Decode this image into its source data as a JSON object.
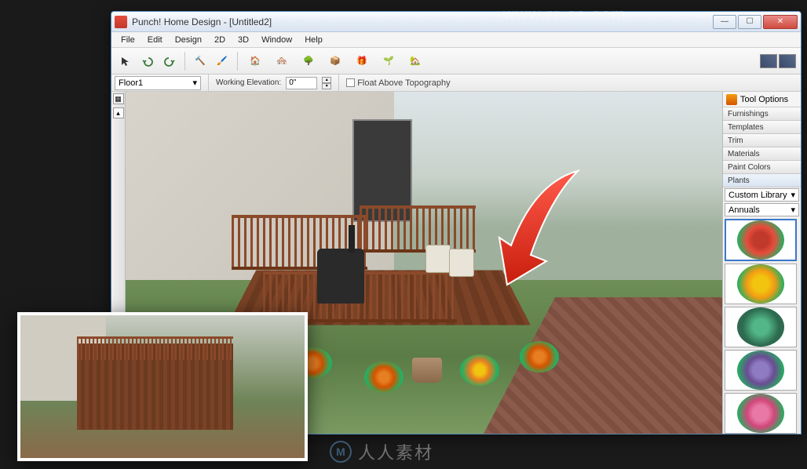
{
  "watermark": "www.rr-sc.com",
  "window": {
    "title": "Punch! Home Design - [Untitled2]"
  },
  "menu": {
    "file": "File",
    "edit": "Edit",
    "design": "Design",
    "two_d": "2D",
    "three_d": "3D",
    "window": "Window",
    "help": "Help"
  },
  "toolbar_icons": {
    "pointer": "pointer-icon",
    "undo": "undo-icon",
    "redo": "redo-icon",
    "hammer": "hammer-icon",
    "brush": "brush-icon",
    "house1": "house-tool-icon",
    "house2": "roof-tool-icon",
    "landscape": "landscape-tool-icon",
    "cube": "cube-tool-icon",
    "gift": "furniture-tool-icon",
    "plant": "plant-tool-icon",
    "home": "home-tool-icon"
  },
  "options": {
    "floor_label": "Floor1",
    "elevation_label": "Working Elevation:",
    "elevation_value": "0\"",
    "float_label": "Float Above Topography"
  },
  "right_panel": {
    "header": "Tool Options",
    "tabs": [
      "Tool Options",
      "Furnishings",
      "Templates",
      "Trim",
      "Materials",
      "Paint Colors",
      "Plants"
    ],
    "selected_tab": "Plants",
    "dropdown1": "Custom Library",
    "dropdown2": "Annuals",
    "thumbs": [
      {
        "name": "plant-red-flower",
        "cls": "tp-red",
        "selected": true
      },
      {
        "name": "plant-yellow-flower",
        "cls": "tp-yellow",
        "selected": false
      },
      {
        "name": "plant-green-shrub",
        "cls": "tp-green",
        "selected": false
      },
      {
        "name": "plant-purple-flower",
        "cls": "tp-purple",
        "selected": false
      },
      {
        "name": "plant-pink-flower",
        "cls": "tp-pink",
        "selected": false
      }
    ]
  },
  "logo_text": "人人素材"
}
